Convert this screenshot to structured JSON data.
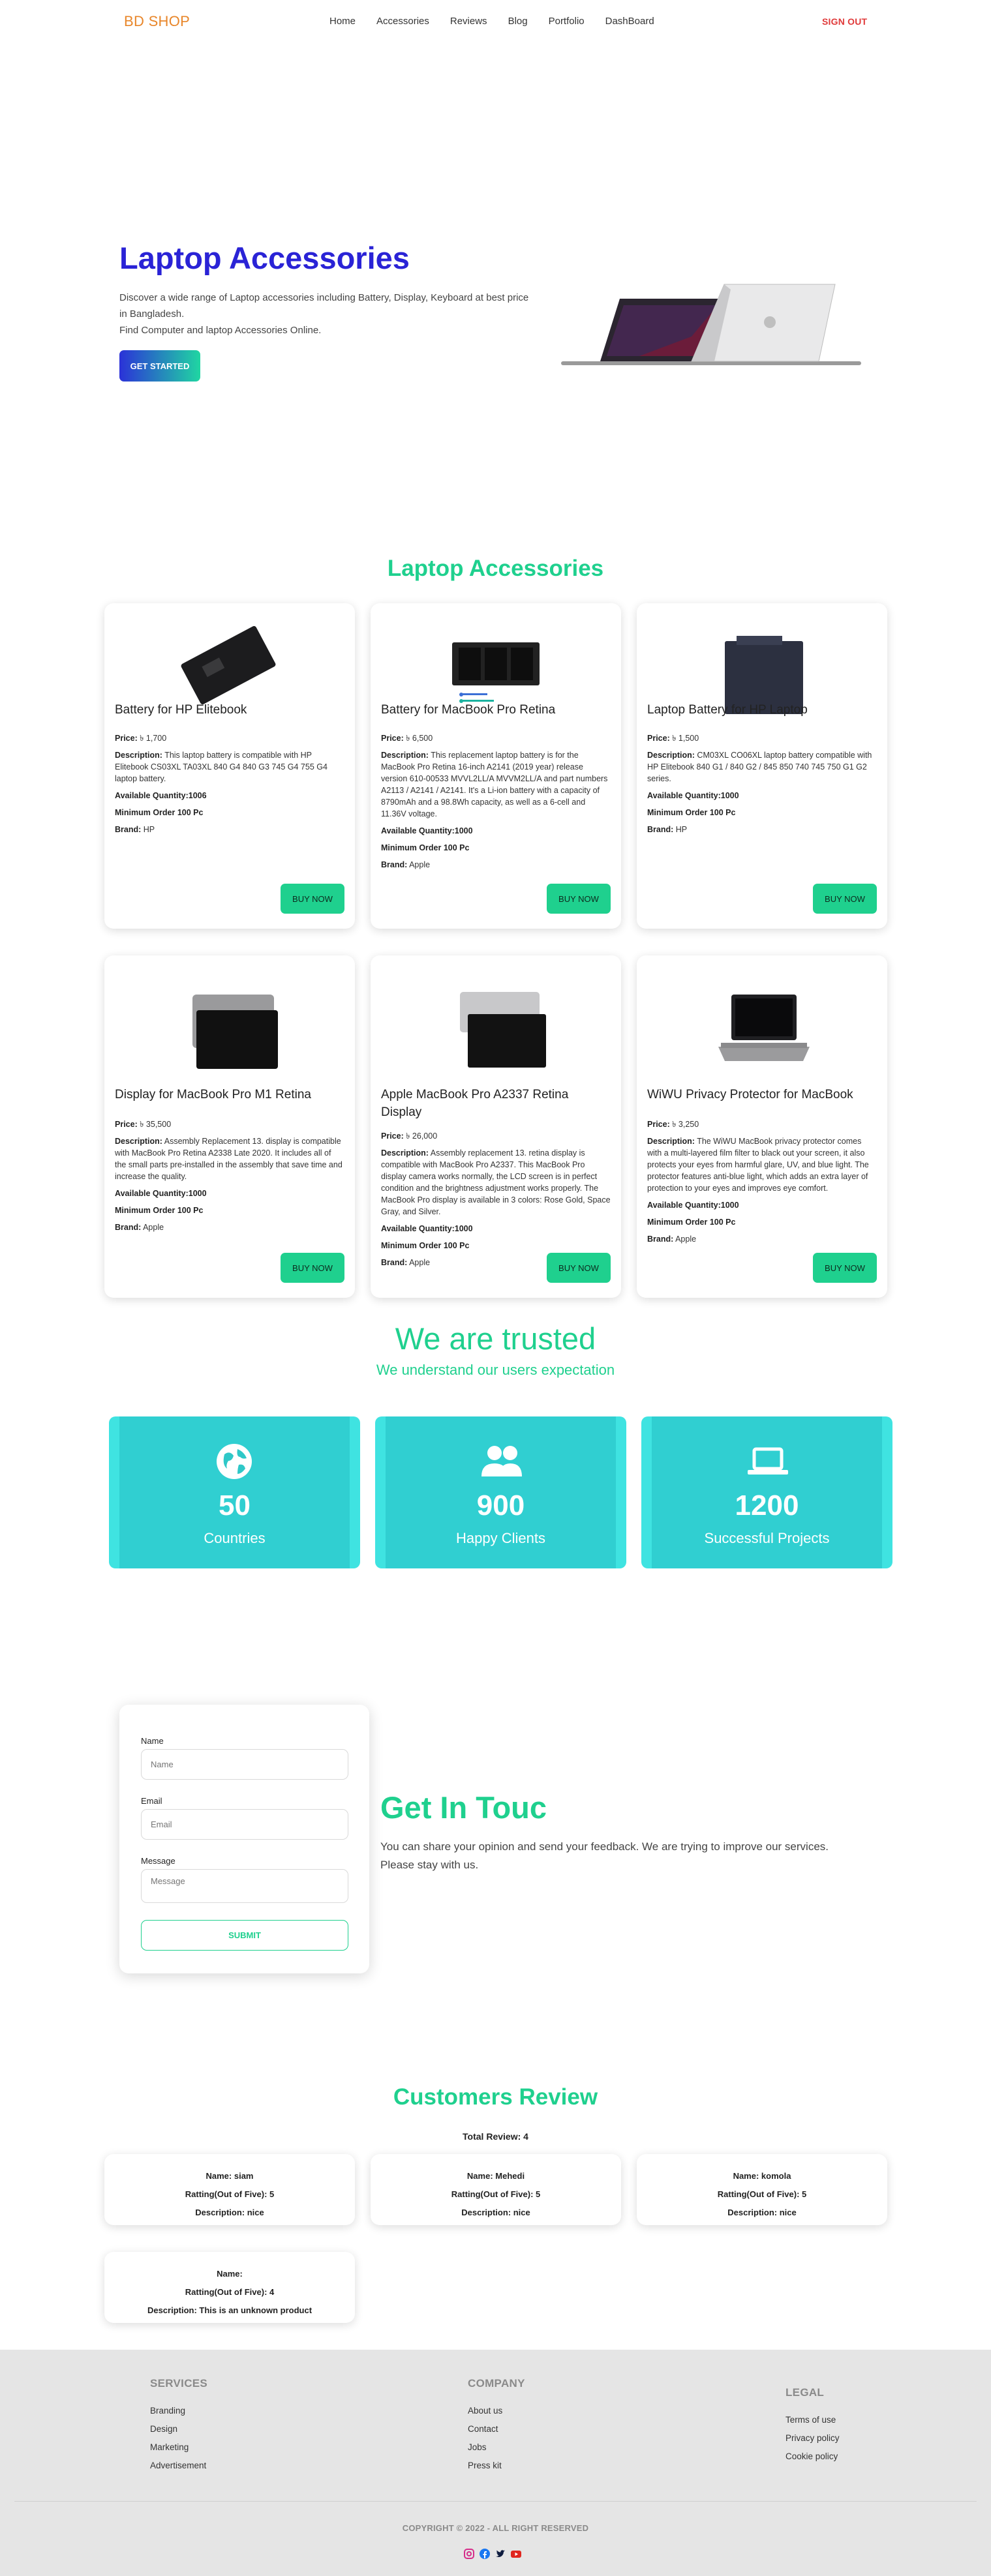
{
  "nav": {
    "brand": "BD SHOP",
    "items": [
      {
        "label": "Home"
      },
      {
        "label": "Accessories"
      },
      {
        "label": "Reviews"
      },
      {
        "label": "Blog"
      },
      {
        "label": "Portfolio"
      },
      {
        "label": "DashBoard"
      }
    ],
    "signout": "SIGN OUT"
  },
  "hero": {
    "title": "Laptop Accessories",
    "desc_line1": "Discover a wide range of Laptop accessories including Battery, Display, Keyboard at best price in Bangladesh.",
    "desc_line2": "Find Computer and laptop Accessories Online.",
    "button": "GET STARTED"
  },
  "products": {
    "title": "Laptop Accessories",
    "labels": {
      "price": "Price:",
      "description": "Description:",
      "available": "Available Quantity:",
      "minimum": "Minimum Order 100 Pc",
      "brand": "Brand:",
      "buy": "BUY NOW"
    },
    "items": [
      {
        "name": "Battery for HP Elitebook",
        "price": "৳ 1,700",
        "description": "This laptop battery is compatible with HP Elitebook CS03XL TA03XL 840 G4 840 G3 745 G4 755 G4 laptop battery.",
        "available": "1006",
        "brand": "HP"
      },
      {
        "name": "Battery for MacBook Pro Retina",
        "price": "৳ 6,500",
        "description": "This replacement laptop battery is for the MacBook Pro Retina 16-inch A2141 (2019 year) release version 610-00533 MVVL2LL/A MVVM2LL/A and part numbers A2113 / A2141 / A2141. It's a Li-ion battery with a capacity of 8790mAh and a 98.8Wh capacity, as well as a 6-cell and 11.36V voltage.",
        "available": "1000",
        "brand": "Apple"
      },
      {
        "name": "Laptop Battery for HP Laptop",
        "price": "৳ 1,500",
        "description": "CM03XL CO06XL laptop battery compatible with HP Elitebook 840 G1 / 840 G2 / 845 850 740 745 750 G1 G2 series.",
        "available": "1000",
        "brand": "HP"
      },
      {
        "name": "Display for MacBook Pro M1 Retina",
        "price": "৳ 35,500",
        "description": "Assembly Replacement 13. display is compatible with MacBook Pro Retina A2338 Late 2020. It includes all of the small parts pre-installed in the assembly that save time and increase the quality.",
        "available": "1000",
        "brand": "Apple"
      },
      {
        "name": "Apple MacBook Pro A2337 Retina Display",
        "price": "৳ 26,000",
        "description": "Assembly replacement 13. retina display is compatible with MacBook Pro A2337. This MacBook Pro display camera works normally, the LCD screen is in perfect condition and the brightness adjustment works properly. The MacBook Pro display is available in 3 colors: Rose Gold, Space Gray, and Silver.",
        "available": "1000",
        "brand": "Apple"
      },
      {
        "name": "WiWU Privacy Protector for MacBook",
        "price": "৳ 3,250",
        "description": "The WiWU MacBook privacy protector comes with a multi-layered film filter to black out your screen, it also protects your eyes from harmful glare, UV, and blue light. The protector features anti-blue light, which adds an extra layer of protection to your eyes and improves eye comfort.",
        "available": "1000",
        "brand": "Apple"
      }
    ]
  },
  "trusted": {
    "title": "We are trusted",
    "subtitle": "We understand our users expectation",
    "stats": [
      {
        "icon": "globe-icon",
        "value": "50",
        "label": "Countries"
      },
      {
        "icon": "users-icon",
        "value": "900",
        "label": "Happy Clients"
      },
      {
        "icon": "laptop-icon",
        "value": "1200",
        "label": "Successful Projects"
      }
    ]
  },
  "contact": {
    "name_label": "Name",
    "name_placeholder": "Name",
    "email_label": "Email",
    "email_placeholder": "Email",
    "message_label": "Message",
    "message_placeholder": "Message",
    "submit": "SUBMIT",
    "title": "Get In Touc",
    "desc": "You can share your opinion and send your feedback. We are trying to improve our services. Please stay with us."
  },
  "reviews": {
    "title": "Customers Review",
    "total": "Total Review: 4",
    "items": [
      {
        "name": "Name: siam",
        "rating": "Ratting(Out of Five): 5",
        "description": "Description: nice"
      },
      {
        "name": "Name: Mehedi",
        "rating": "Ratting(Out of Five): 5",
        "description": "Description: nice"
      },
      {
        "name": "Name: komola",
        "rating": "Ratting(Out of Five): 5",
        "description": "Description: nice"
      },
      {
        "name": "Name:",
        "rating": "Ratting(Out of Five): 4",
        "description": "Description: This is an unknown product"
      }
    ]
  },
  "footer": {
    "services": {
      "title": "SERVICES",
      "links": [
        "Branding",
        "Design",
        "Marketing",
        "Advertisement"
      ]
    },
    "company": {
      "title": "COMPANY",
      "links": [
        "About us",
        "Contact",
        "Jobs",
        "Press kit"
      ]
    },
    "legal": {
      "title": "LEGAL",
      "links": [
        "Terms of use",
        "Privacy policy",
        "Cookie policy"
      ]
    },
    "copyright": "COPYRIGHT © 2022 - ALL RIGHT RESERVED",
    "socials": [
      "instagram-icon",
      "facebook-icon",
      "twitter-icon",
      "youtube-icon"
    ]
  },
  "colors": {
    "brand": "#e8862a",
    "hero_title": "#2a23d6",
    "accent": "#1fd08e",
    "signout": "#e03a3a",
    "stat_bg": "#3fe3e1"
  }
}
